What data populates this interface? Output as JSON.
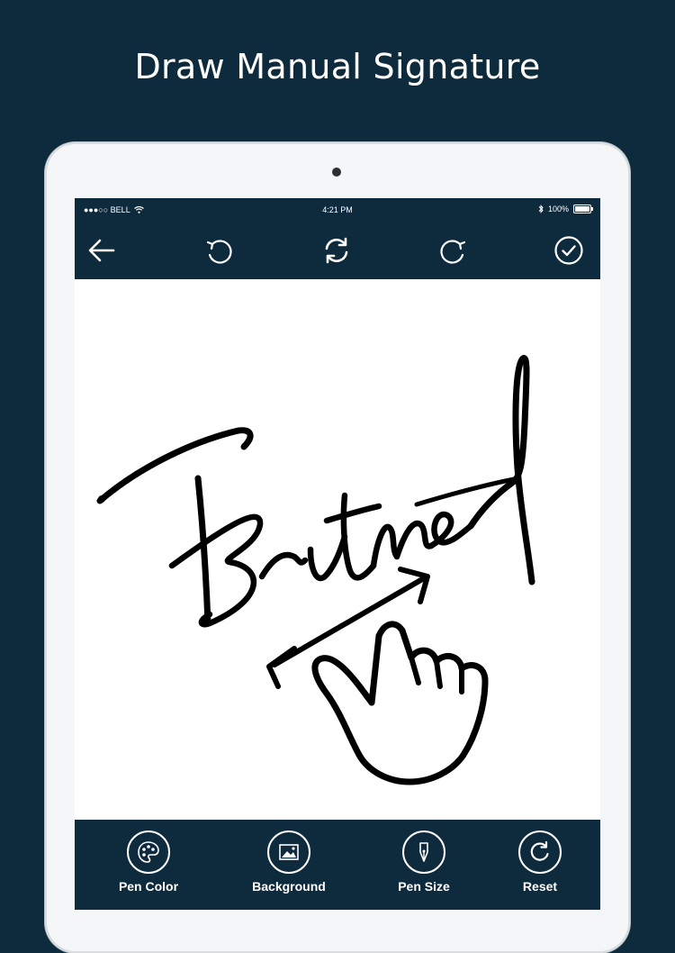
{
  "headline": "Draw Manual Signature",
  "status_bar": {
    "carrier": "●●●○○ BELL",
    "time": "4:21 PM",
    "battery": "100%",
    "icons": [
      "wifi-icon",
      "bluetooth-icon",
      "battery-icon"
    ]
  },
  "toolbar": {
    "icons": [
      "back-arrow-icon",
      "undo-icon",
      "refresh-icon",
      "redo-icon",
      "check-circle-icon"
    ]
  },
  "bottom_bar": {
    "items": [
      {
        "label": "Pen Color",
        "icon": "palette-icon"
      },
      {
        "label": "Background",
        "icon": "image-icon"
      },
      {
        "label": "Pen Size",
        "icon": "pen-nib-icon"
      },
      {
        "label": "Reset",
        "icon": "reset-icon"
      }
    ]
  },
  "colors": {
    "background": "#0e2a3d",
    "toolbar": "#0e2a3d",
    "canvas": "#ffffff",
    "ink": "#000000"
  }
}
